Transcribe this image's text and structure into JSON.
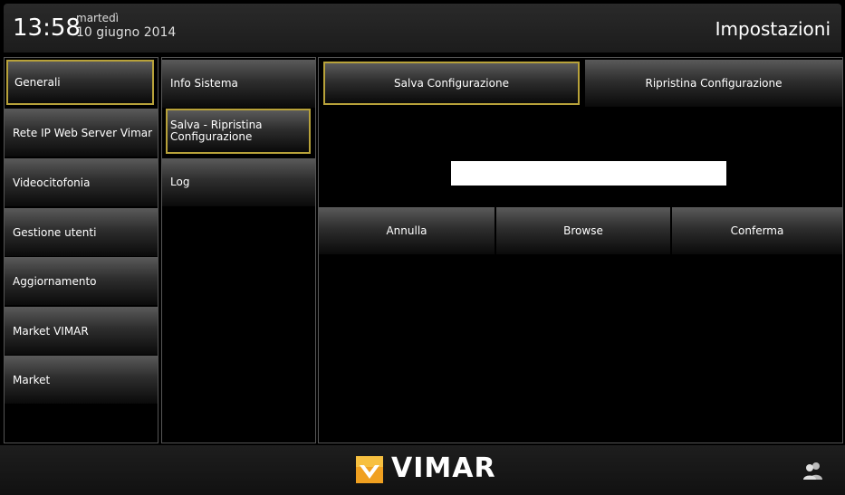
{
  "header": {
    "time": "13:58",
    "weekday": "martedì",
    "date": "10 giugno 2014",
    "title": "Impostazioni"
  },
  "menu_left": [
    {
      "label": "Generali",
      "selected": true
    },
    {
      "label": "Rete IP Web Server Vimar",
      "selected": false
    },
    {
      "label": "Videocitofonia",
      "selected": false
    },
    {
      "label": "Gestione utenti",
      "selected": false
    },
    {
      "label": "Aggiornamento",
      "selected": false
    },
    {
      "label": "Market VIMAR",
      "selected": false
    },
    {
      "label": "Market",
      "selected": false
    }
  ],
  "menu_sub": [
    {
      "label": "Info Sistema",
      "selected": false
    },
    {
      "label": "Salva - Ripristina Configurazione",
      "selected": true
    },
    {
      "label": "Log",
      "selected": false
    }
  ],
  "content": {
    "save_label": "Salva Configurazione",
    "restore_label": "Ripristina Configurazione",
    "file_field_value": "",
    "annulla_label": "Annulla",
    "browse_label": "Browse",
    "conferma_label": "Conferma"
  },
  "footer": {
    "brand": "VIMAR",
    "logo_icon": "vimar-logo-icon",
    "users_icon": "users-icon"
  },
  "colors": {
    "selection_border": "#b8a23a",
    "background": "#000000"
  }
}
